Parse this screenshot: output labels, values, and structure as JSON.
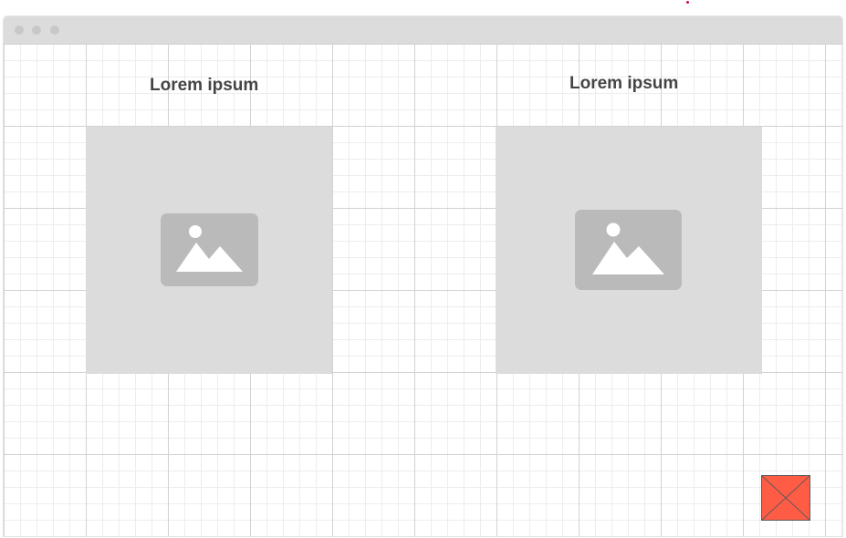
{
  "colors": {
    "title_bar": "#dcdcdc",
    "placeholder_fill": "#dcdcdc",
    "placeholder_icon": "#bababa",
    "close_button": "#ff5c45",
    "marker_dot": "#d0103a"
  },
  "left_card": {
    "title": "Lorem ipsum",
    "image_icon": "image-placeholder-icon"
  },
  "right_card": {
    "title": "Lorem ipsum",
    "image_icon": "image-placeholder-icon"
  },
  "close_button": {
    "icon": "close-x-icon"
  }
}
